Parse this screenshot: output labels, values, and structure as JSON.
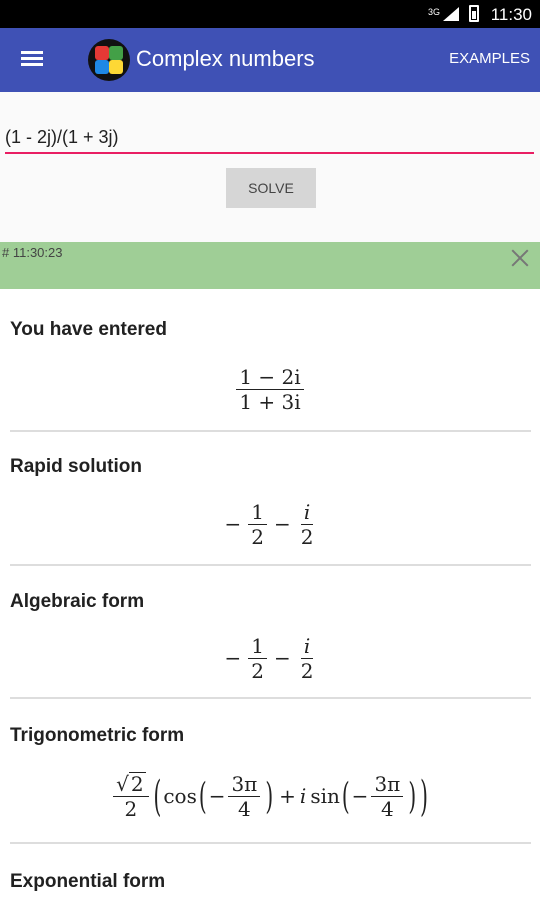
{
  "status_bar": {
    "network": "3G",
    "time": "11:30"
  },
  "app_bar": {
    "title": "Complex numbers",
    "examples_label": "EXAMPLES",
    "logo_colors": [
      "#e53935",
      "#43a047",
      "#1e88e5",
      "#fdd835"
    ]
  },
  "input": {
    "value": "(1 - 2j)/(1 + 3j)",
    "placeholder": "",
    "solve_label": "SOLVE"
  },
  "banner": {
    "timestamp": "# 11:30:23"
  },
  "results": {
    "entered": {
      "title": "You have entered",
      "numerator": "1 − 2i",
      "denominator": "1 + 3i"
    },
    "rapid": {
      "title": "Rapid solution",
      "sign1": "−",
      "frac1_num": "1",
      "frac1_den": "2",
      "op": "−",
      "frac2_num": "i",
      "frac2_den": "2"
    },
    "algebraic": {
      "title": "Algebraic form",
      "sign1": "−",
      "frac1_num": "1",
      "frac1_den": "2",
      "op": "−",
      "frac2_num": "i",
      "frac2_den": "2"
    },
    "trigonometric": {
      "title": "Trigonometric form",
      "coef_num": "2",
      "coef_den": "2",
      "cos": "cos",
      "sin": "sin",
      "i": "i",
      "plus": "+",
      "minus": "−",
      "angle_num": "3π",
      "angle_den": "4"
    },
    "exponential": {
      "title": "Exponential form"
    }
  }
}
